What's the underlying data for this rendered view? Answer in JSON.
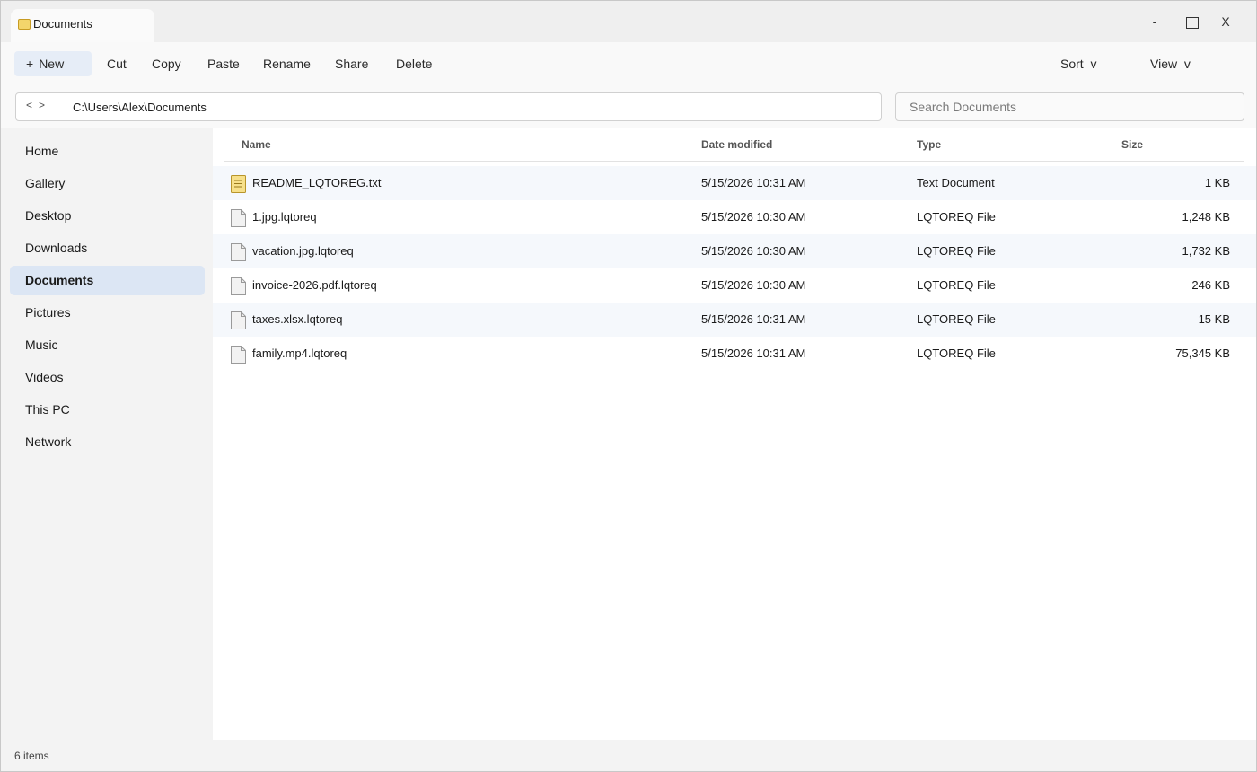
{
  "window": {
    "tab_title": "Documents",
    "controls": {
      "minimize": "-",
      "close": "X"
    }
  },
  "toolbar": {
    "new_plus": "+",
    "new_label": "New",
    "cut": "Cut",
    "copy": "Copy",
    "paste": "Paste",
    "rename": "Rename",
    "share": "Share",
    "delete": "Delete",
    "sort": "Sort  v",
    "view": "View  v"
  },
  "address": {
    "back": "<",
    "forward": ">",
    "path": "C:\\Users\\Alex\\Documents"
  },
  "search": {
    "placeholder": "Search Documents"
  },
  "sidebar": {
    "items": [
      {
        "label": "Home"
      },
      {
        "label": "Gallery"
      },
      {
        "label": "Desktop"
      },
      {
        "label": "Downloads"
      },
      {
        "label": "Documents",
        "active": true
      },
      {
        "label": "Pictures"
      },
      {
        "label": "Music"
      },
      {
        "label": "Videos"
      },
      {
        "label": "This PC"
      },
      {
        "label": "Network"
      }
    ]
  },
  "columns": {
    "name": "Name",
    "date": "Date modified",
    "type": "Type",
    "size": "Size"
  },
  "files": [
    {
      "icon": "text-document-icon",
      "name": "README_LQTOREG.txt",
      "date": "5/15/2026 10:31 AM",
      "type": "Text Document",
      "size": "1 KB"
    },
    {
      "icon": "file-icon",
      "name": "1.jpg.lqtoreq",
      "date": "5/15/2026 10:30 AM",
      "type": "LQTOREQ File",
      "size": "1,248 KB"
    },
    {
      "icon": "file-icon",
      "name": "vacation.jpg.lqtoreq",
      "date": "5/15/2026 10:30 AM",
      "type": "LQTOREQ File",
      "size": "1,732 KB"
    },
    {
      "icon": "file-icon",
      "name": "invoice-2026.pdf.lqtoreq",
      "date": "5/15/2026 10:30 AM",
      "type": "LQTOREQ File",
      "size": "246 KB"
    },
    {
      "icon": "file-icon",
      "name": "taxes.xlsx.lqtoreq",
      "date": "5/15/2026 10:31 AM",
      "type": "LQTOREQ File",
      "size": "15 KB"
    },
    {
      "icon": "file-icon",
      "name": "family.mp4.lqtoreq",
      "date": "5/15/2026 10:31 AM",
      "type": "LQTOREQ File",
      "size": "75,345 KB"
    }
  ],
  "status": {
    "item_count": "6 items"
  },
  "colors": {
    "accent": "#dce6f4",
    "folder": "#f3d56b",
    "text_doc": "#f7e08a",
    "row_alt": "#f5f8fc"
  }
}
